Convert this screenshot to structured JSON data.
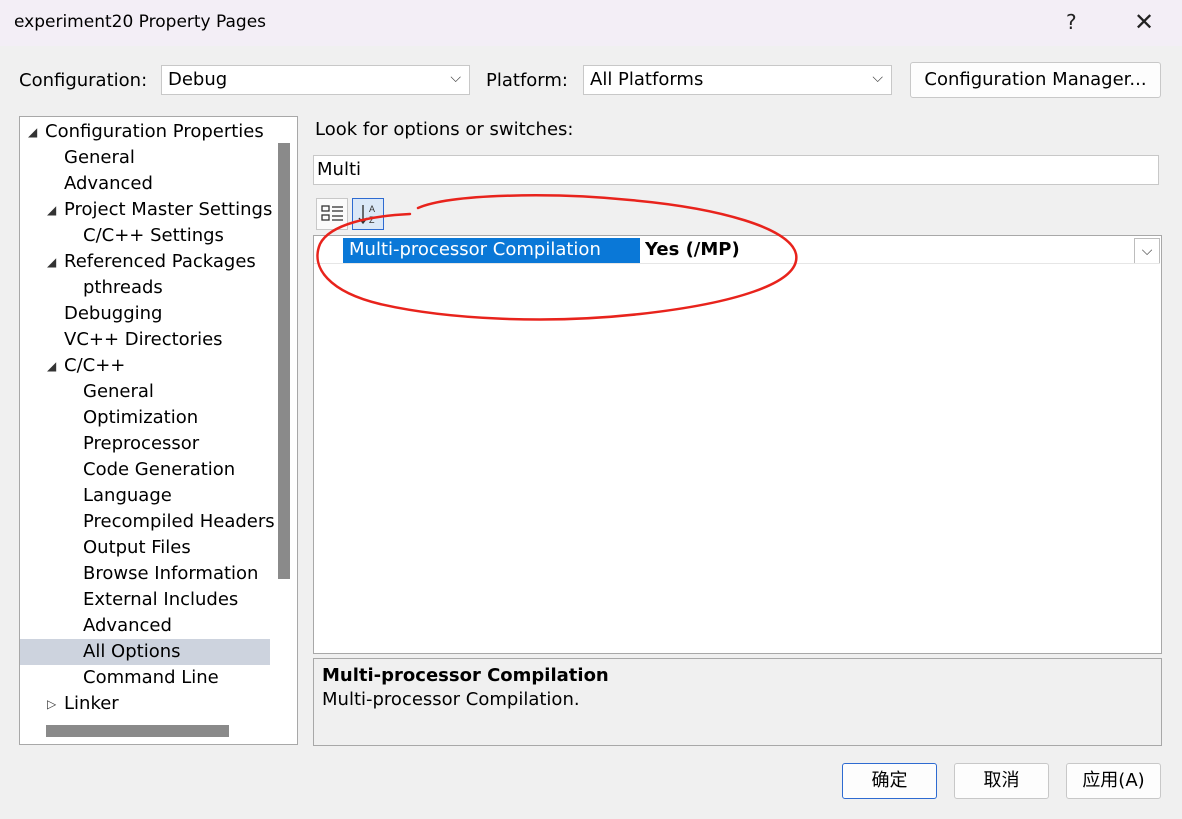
{
  "window": {
    "title": "experiment20 Property Pages",
    "help_label": "?",
    "close_label": "✕"
  },
  "top": {
    "config_label": "Configuration:",
    "config_value": "Debug",
    "platform_label": "Platform:",
    "platform_value": "All Platforms",
    "config_manager_label": "Configuration Manager..."
  },
  "tree": {
    "items": [
      {
        "label": "Configuration Properties",
        "expand": "down"
      },
      {
        "label": "General"
      },
      {
        "label": "Advanced"
      },
      {
        "label": "Project Master Settings",
        "expand": "down"
      },
      {
        "label": "C/C++ Settings"
      },
      {
        "label": "Referenced Packages",
        "expand": "down"
      },
      {
        "label": "pthreads"
      },
      {
        "label": "Debugging"
      },
      {
        "label": "VC++ Directories"
      },
      {
        "label": "C/C++",
        "expand": "down"
      },
      {
        "label": "General"
      },
      {
        "label": "Optimization"
      },
      {
        "label": "Preprocessor"
      },
      {
        "label": "Code Generation"
      },
      {
        "label": "Language"
      },
      {
        "label": "Precompiled Headers"
      },
      {
        "label": "Output Files"
      },
      {
        "label": "Browse Information"
      },
      {
        "label": "External Includes"
      },
      {
        "label": "Advanced"
      },
      {
        "label": "All Options",
        "selected": true
      },
      {
        "label": "Command Line"
      },
      {
        "label": "Linker",
        "expand": "right"
      }
    ]
  },
  "search": {
    "label": "Look for options or switches:",
    "value": "Multi"
  },
  "toolbar": {
    "categorized_icon": "categorized-list-icon",
    "alpha_icon": "sort-alphabetical-icon"
  },
  "grid": {
    "rows": [
      {
        "name": "Multi-processor Compilation",
        "value": "Yes (/MP)"
      }
    ]
  },
  "description": {
    "title": "Multi-processor Compilation",
    "text": "Multi-processor Compilation."
  },
  "buttons": {
    "ok": "确定",
    "cancel": "取消",
    "apply": "应用(A)"
  },
  "colors": {
    "selection": "#0a78d7",
    "tree_selected": "#cdd3de",
    "annotation": "#e8231c"
  }
}
